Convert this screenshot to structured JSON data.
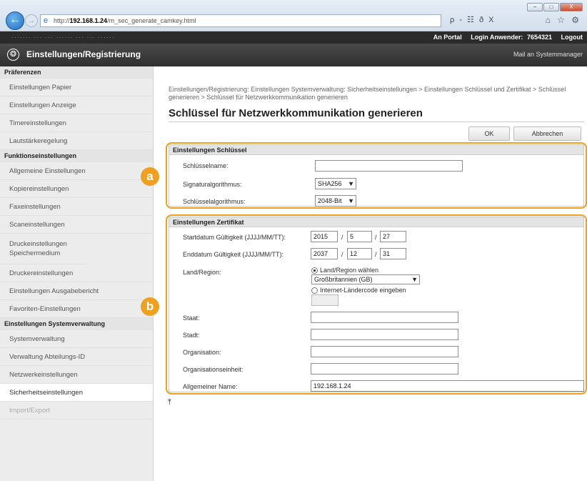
{
  "browser": {
    "url_prefix": "http://",
    "url_host": "192.168.1.24",
    "url_path": "/m_sec_generate_camkey.html",
    "window_buttons": [
      "–",
      "□",
      "X"
    ],
    "addr_tools": "ρ - ☷ ð X",
    "fav_tools": "⌂ ☆ ⚙"
  },
  "topbar": {
    "device_name_blurred": "·······   ··· ··· ······  ··· ··· ······",
    "portal": "An Portal",
    "login_label": "Login Anwender:",
    "login_id": "7654321",
    "logout": "Logout"
  },
  "header": {
    "title": "Einstellungen/Registrierung",
    "mail_admin": "Mail an Systemmanager"
  },
  "sidebar": {
    "head_1": "Präferenzen",
    "group_1": [
      "Einstellungen Papier",
      "Einstellungen Anzeige",
      "Timereinstellungen",
      "Lautstärkeregelung"
    ],
    "head_2": "Funktionseinstellungen",
    "group_2": [
      "Allgemeine Einstellungen",
      "Kopiereinstellungen",
      "Faxeinstellungen",
      "Scaneinstellungen",
      "Druckeinstellungen Speichermedium",
      "Druckereinstellungen",
      "Einstellungen Ausgabebericht",
      "Favoriten-Einstellungen"
    ],
    "head_3": "Einstellungen Systemverwaltung",
    "group_3": [
      "Systemverwaltung",
      "Verwaltung Abteilungs-ID",
      "Netzwerkeinstellungen",
      "Sicherheitseinstellungen",
      "Import/Export"
    ]
  },
  "main": {
    "breadcrumb": "Einstellungen/Registrierung: Einstellungen Systemverwaltung: Sicherheitseinstellungen > Einstellungen Schlüssel und Zertifikat > Schlüssel generieren > Schlüssel für Netzwerkkommunikation generieren",
    "title": "Schlüssel für Netzwerkkommunikation generieren",
    "ok": "OK",
    "cancel": "Abbrechen",
    "key_settings": {
      "heading": "Einstellungen Schlüssel",
      "key_name_label": "Schlüsselname:",
      "key_name_value": "",
      "signature_label": "Signaturalgorithmus:",
      "signature_value": "SHA256",
      "key_algo_label": "Schlüsselalgorithmus:",
      "key_algo_value": "2048-Bit"
    },
    "cert_settings": {
      "heading": "Einstellungen Zertifikat",
      "start_label": "Startdatum Gültigkeit (JJJJ/MM/TT):",
      "start_year": "2015",
      "start_month": "5",
      "start_day": "27",
      "end_label": "Enddatum Gültigkeit (JJJJ/MM/TT):",
      "end_year": "2037",
      "end_month": "12",
      "end_day": "31",
      "slash": "/",
      "country_label": "Land/Region:",
      "radio_select": "Land/Region wählen",
      "country_value": "Großbritannien (GB)",
      "radio_internet": "Internet-Ländercode eingeben",
      "state_label": "Staat:",
      "city_label": "Stadt:",
      "org_label": "Organisation:",
      "org_unit_label": "Organisationseinheit:",
      "common_name_label": "Allgemeiner Name:",
      "common_name_value": "192.168.1.24"
    },
    "marker_a": "a",
    "marker_b": "b",
    "page_top_icon": "⤒"
  },
  "accent_color": "#f0a020"
}
